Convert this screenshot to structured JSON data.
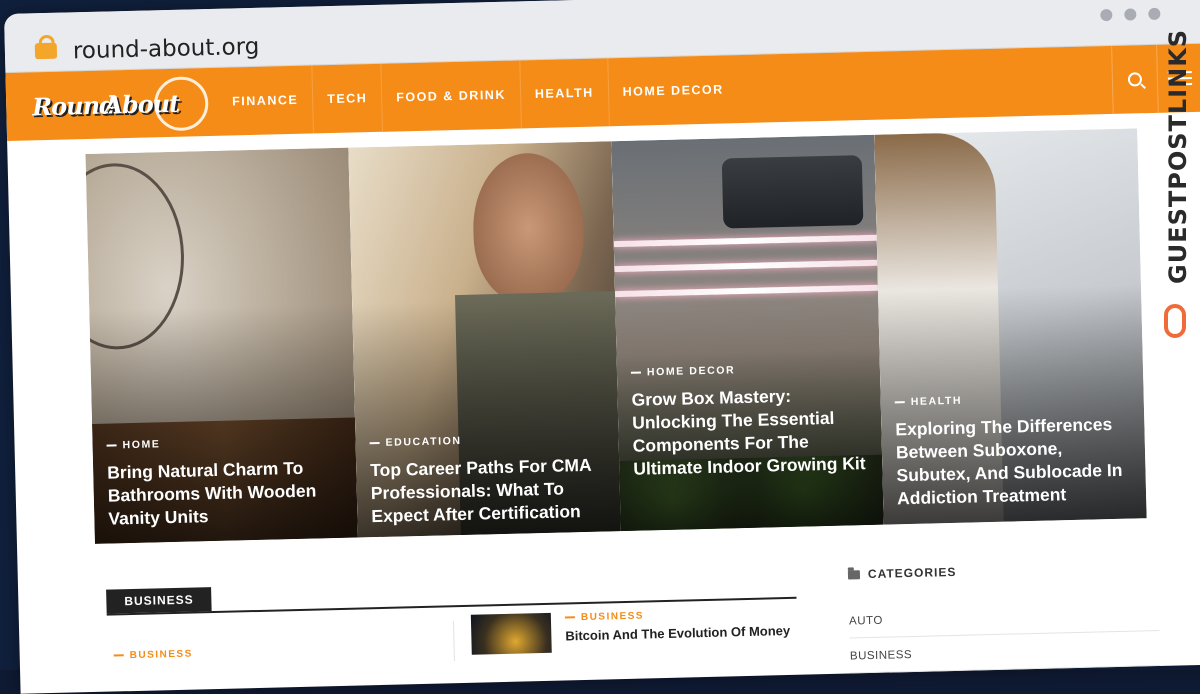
{
  "browser": {
    "url": "round-about.org"
  },
  "logo": {
    "word1": "Round",
    "word2": "About"
  },
  "nav": {
    "items": [
      "FINANCE",
      "TECH",
      "FOOD & DRINK",
      "HEALTH",
      "HOME DECOR"
    ]
  },
  "hero": [
    {
      "category": "HOME",
      "title": "Bring Natural Charm To Bathrooms With Wooden Vanity Units"
    },
    {
      "category": "EDUCATION",
      "title": "Top Career Paths For CMA Professionals: What To Expect After Certification"
    },
    {
      "category": "HOME DECOR",
      "title": "Grow Box Mastery: Unlocking The Essential Components For The Ultimate Indoor Growing Kit"
    },
    {
      "category": "HEALTH",
      "title": "Exploring The Differences Between Suboxone, Subutex, And Sublocade In Addiction Treatment"
    }
  ],
  "main": {
    "section_label": "BUSINESS",
    "left_post": {
      "category": "BUSINESS"
    },
    "right_post": {
      "category": "BUSINESS",
      "title": "Bitcoin And The Evolution Of Money"
    }
  },
  "sidebar": {
    "heading": "CATEGORIES",
    "items": [
      "AUTO",
      "BUSINESS"
    ]
  },
  "badge": {
    "text": "GUESTPOSTLINKS"
  },
  "colors": {
    "accent": "#f58c18",
    "dark": "#222222"
  }
}
